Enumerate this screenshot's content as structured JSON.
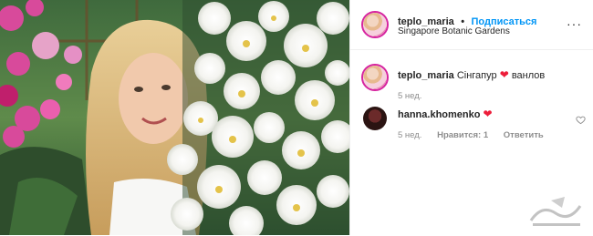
{
  "post": {
    "username": "teplo_maria",
    "separator": "•",
    "follow_label": "Подписаться",
    "location": "Singapore Botanic Gardens",
    "more_label": "···"
  },
  "caption": {
    "username": "teplo_maria",
    "text_before": "Сінгапур",
    "emoji": "❤",
    "text_after": "ванлов",
    "time": "5 нед."
  },
  "comments": [
    {
      "username": "hanna.khomenko",
      "emoji": "❤",
      "time": "5 нед.",
      "likes": "Нравится: 1",
      "reply_label": "Ответить"
    }
  ],
  "icons": {
    "more": "more-horizontal-icon",
    "like": "heart-outline-icon",
    "watermark": "watermark-logo"
  },
  "colors": {
    "follow": "#0095f6",
    "heart": "#ed1d3a",
    "border": "#efefef",
    "muted": "#8e8e8e"
  }
}
